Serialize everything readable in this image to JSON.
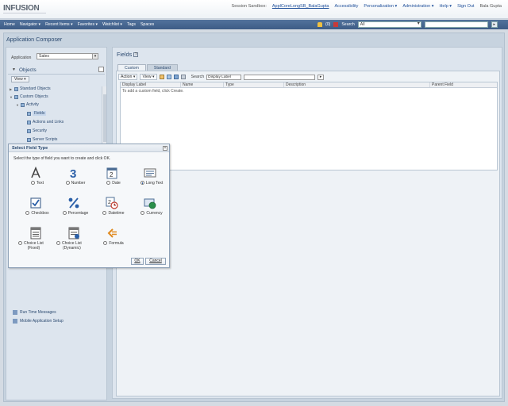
{
  "header": {
    "logo": "INFUSION",
    "session_label": "Session Sandbox:",
    "session_value": "ApplCoreLongSB_BalaGupta",
    "links": [
      "Accessibility",
      "Personalization ▾",
      "Administration ▾",
      "Help ▾",
      "Sign Out"
    ],
    "user": "Bala Gupta"
  },
  "nav": {
    "items": [
      "Home",
      "Navigator ▾",
      "Recent Items ▾",
      "Favorites ▾",
      "Watchlist ▾",
      "Tags",
      "Spaces"
    ],
    "notifications": "(0)",
    "search_label": "Search",
    "search_scope": "All",
    "go_label": "▸"
  },
  "app_title": "Application Composer",
  "left": {
    "app_label": "Application",
    "app_value": "Sales",
    "objects_title": "Objects",
    "view_label": "View ▾",
    "tree": [
      {
        "label": "Standard Objects"
      },
      {
        "label": "Custom Objects"
      },
      {
        "label": "Activity"
      },
      {
        "label": "Fields"
      },
      {
        "label": "Actions and Links"
      },
      {
        "label": "Security"
      },
      {
        "label": "Server Scripts"
      }
    ],
    "lower": [
      {
        "label": "Run Time Messages"
      },
      {
        "label": "Mobile Application Setup"
      }
    ]
  },
  "fields_panel": {
    "title": "Fields",
    "help": "?",
    "tabs": [
      "Custom",
      "Standard"
    ],
    "toolbar": {
      "action": "Action ▾",
      "view": "View ▾",
      "search_label": "Search",
      "search_field": "Display Label",
      "go": "▸"
    },
    "columns": [
      "Display Label",
      "Name",
      "Type",
      "Description",
      "Parent Field"
    ],
    "empty_message": "To add a custom field, click Create."
  },
  "dialog": {
    "title": "Select Field Type",
    "close": "×",
    "instructions": "Select the type of field you want to create and click OK.",
    "types": [
      {
        "label": "Text",
        "icon": "text-a-icon",
        "selected": false
      },
      {
        "label": "Number",
        "icon": "number-3-icon",
        "selected": false
      },
      {
        "label": "Date",
        "icon": "calendar-icon",
        "selected": false
      },
      {
        "label": "Long Text",
        "icon": "long-text-icon",
        "selected": true
      },
      {
        "label": "Checkbox",
        "icon": "checkbox-icon",
        "selected": false
      },
      {
        "label": "Percentage",
        "icon": "percent-icon",
        "selected": false
      },
      {
        "label": "Datetime",
        "icon": "datetime-icon",
        "selected": false
      },
      {
        "label": "Currency",
        "icon": "currency-icon",
        "selected": false
      },
      {
        "label": "Choice List\n(Fixed)",
        "icon": "fixed-choice-list-icon",
        "selected": false
      },
      {
        "label": "Choice List\n(Dynamic)",
        "icon": "dynamic-choice-list-icon",
        "selected": false
      },
      {
        "label": "Formula",
        "icon": "formula-icon",
        "selected": false
      }
    ],
    "ok": "OK",
    "cancel": "Cancel"
  }
}
